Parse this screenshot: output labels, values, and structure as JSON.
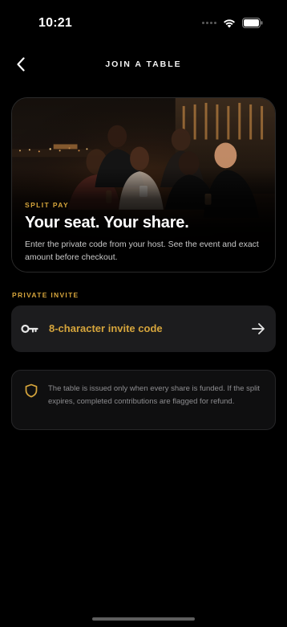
{
  "status_bar": {
    "time": "10:21"
  },
  "header": {
    "title": "JOIN A TABLE"
  },
  "hero": {
    "kicker": "SPLIT PAY",
    "title": "Your seat. Your share.",
    "description": "Enter the private code from your host. See the event and exact amount before checkout."
  },
  "invite": {
    "section_label": "PRIVATE INVITE",
    "placeholder": "8-character invite code"
  },
  "notice": {
    "text": "The table is issued only when every share is funded. If the split expires, completed contributions are flagged for refund."
  },
  "colors": {
    "accent": "#d6a53c",
    "background": "#000000",
    "field_bg": "#1c1c1e"
  },
  "icons": {
    "back": "chevron-left-icon",
    "key": "key-icon",
    "submit": "arrow-right-icon",
    "notice": "shield-icon"
  }
}
